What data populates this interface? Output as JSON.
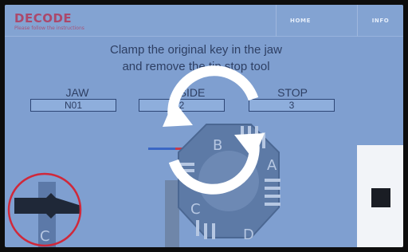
{
  "header": {
    "brand": "DECODE",
    "subtitle": "Please follow the instructions",
    "nav": [
      {
        "label": "HOME"
      },
      {
        "label": "INFO"
      }
    ]
  },
  "instruction": {
    "line1": "Clamp the original key in the jaw",
    "line2": "and remove the tip stop tool"
  },
  "params": [
    {
      "label": "JAW",
      "value": "N01"
    },
    {
      "label": "SIDE",
      "value": "2"
    },
    {
      "label": "STOP",
      "value": "3"
    }
  ],
  "jaw_diagram": {
    "face_labels": [
      "A",
      "B",
      "C",
      "D"
    ]
  },
  "tool_detail": {
    "label": "C"
  },
  "colors": {
    "screen_bg": "#7f9fd0",
    "brand": "#b3395a",
    "text": "#2e3f63",
    "highlight_circle": "#d0283a",
    "refresh_arrows": "#ffffff"
  },
  "icons": [
    "refresh-arrows-icon"
  ]
}
